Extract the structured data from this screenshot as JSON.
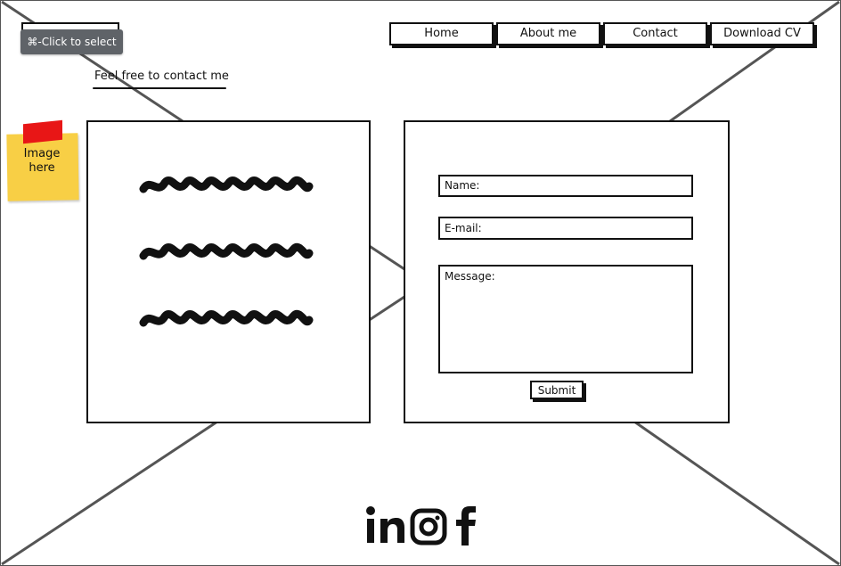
{
  "tooltip": {
    "text": "⌘-Click to select"
  },
  "nav": {
    "items": [
      {
        "label": "Home"
      },
      {
        "label": "About me"
      },
      {
        "label": "Contact"
      },
      {
        "label": "Download CV"
      }
    ]
  },
  "hero": {
    "subtitle": "Feel free to contact me"
  },
  "sticky_note": {
    "text_line1": "Image",
    "text_line2": "here"
  },
  "form": {
    "name_label": "Name:",
    "email_label": "E-mail:",
    "message_label": "Message:",
    "submit_label": "Submit"
  },
  "social": {
    "icons": [
      "linkedin-icon",
      "instagram-icon",
      "facebook-icon"
    ]
  },
  "colors": {
    "tooltip_bg": "#5f6368",
    "note_yellow": "#f8cf45",
    "note_tape": "#e81616",
    "ink": "#111111"
  }
}
